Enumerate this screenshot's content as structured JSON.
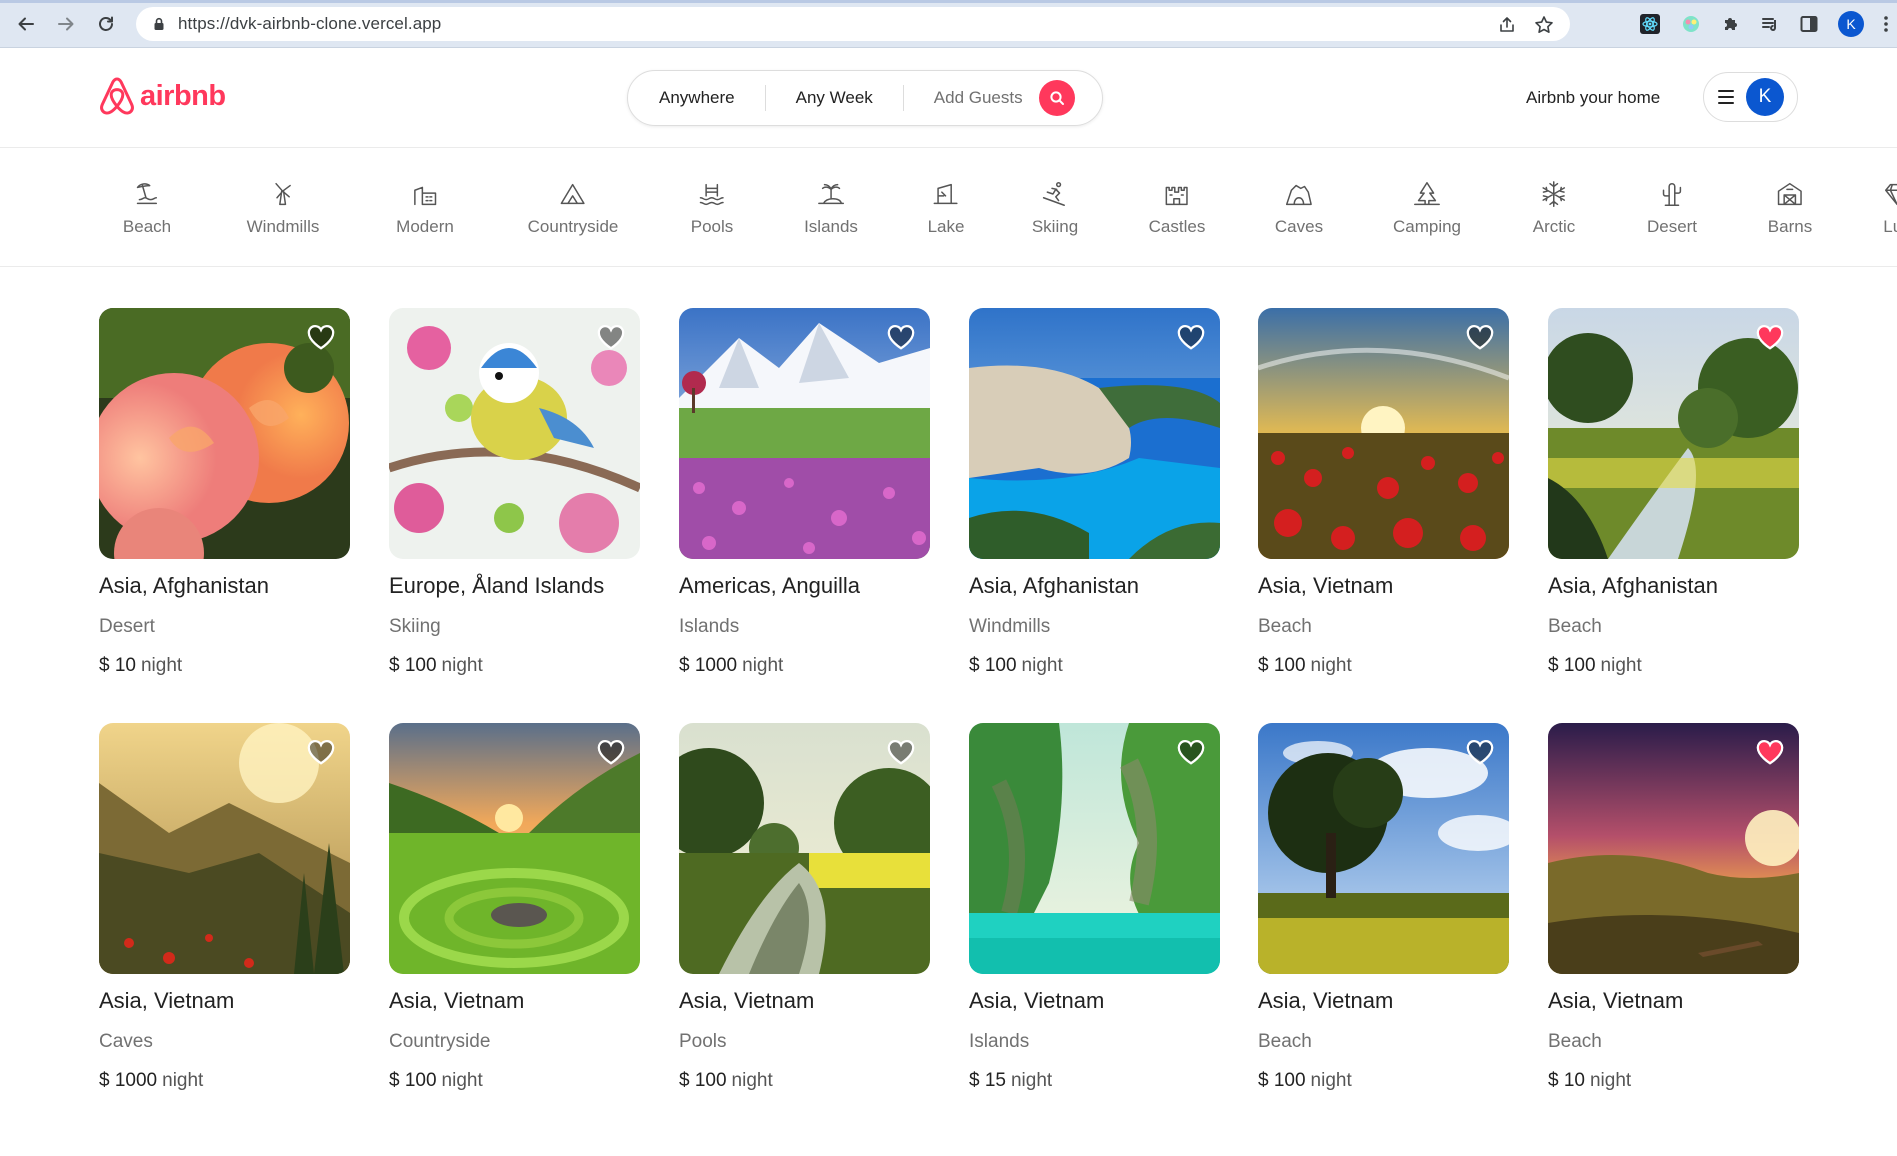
{
  "browser": {
    "url": "https://dvk-airbnb-clone.vercel.app",
    "profile_initial": "K"
  },
  "header": {
    "logo_text": "airbnb",
    "search": {
      "where": "Anywhere",
      "when": "Any Week",
      "who": "Add Guests"
    },
    "host_link": "Airbnb your home",
    "user_initial": "K"
  },
  "categories": [
    {
      "label": "Beach",
      "icon": "beach-icon"
    },
    {
      "label": "Windmills",
      "icon": "windmill-icon"
    },
    {
      "label": "Modern",
      "icon": "modern-building-icon"
    },
    {
      "label": "Countryside",
      "icon": "countryside-icon"
    },
    {
      "label": "Pools",
      "icon": "pool-icon"
    },
    {
      "label": "Islands",
      "icon": "island-icon"
    },
    {
      "label": "Lake",
      "icon": "lake-icon"
    },
    {
      "label": "Skiing",
      "icon": "skiing-icon"
    },
    {
      "label": "Castles",
      "icon": "castle-icon"
    },
    {
      "label": "Caves",
      "icon": "cave-icon"
    },
    {
      "label": "Camping",
      "icon": "camping-icon"
    },
    {
      "label": "Arctic",
      "icon": "snowflake-icon"
    },
    {
      "label": "Desert",
      "icon": "cactus-icon"
    },
    {
      "label": "Barns",
      "icon": "barn-icon"
    },
    {
      "label": "Lux",
      "icon": "diamond-icon"
    }
  ],
  "listings": [
    {
      "location": "Asia, Afghanistan",
      "category": "Desert",
      "price": "$ 10",
      "unit": "night",
      "favorite": false,
      "image": "orange-roses-photo"
    },
    {
      "location": "Europe, Åland Islands",
      "category": "Skiing",
      "price": "$ 100",
      "unit": "night",
      "favorite": false,
      "image": "blue-tit-bird-photo"
    },
    {
      "location": "Americas, Anguilla",
      "category": "Islands",
      "price": "$ 1000",
      "unit": "night",
      "favorite": false,
      "image": "mountain-flower-meadow-photo"
    },
    {
      "location": "Asia, Afghanistan",
      "category": "Windmills",
      "price": "$ 100",
      "unit": "night",
      "favorite": false,
      "image": "navagio-cove-photo"
    },
    {
      "location": "Asia, Vietnam",
      "category": "Beach",
      "price": "$ 100",
      "unit": "night",
      "favorite": false,
      "image": "poppy-field-sunset-photo"
    },
    {
      "location": "Asia, Afghanistan",
      "category": "Beach",
      "price": "$ 100",
      "unit": "night",
      "favorite": true,
      "image": "forest-stream-photo"
    },
    {
      "location": "Asia, Vietnam",
      "category": "Caves",
      "price": "$ 1000",
      "unit": "night",
      "favorite": false,
      "image": "mountain-valley-sunlight-photo"
    },
    {
      "location": "Asia, Vietnam",
      "category": "Countryside",
      "price": "$ 100",
      "unit": "night",
      "favorite": false,
      "image": "green-hills-stone-circle-photo"
    },
    {
      "location": "Asia, Vietnam",
      "category": "Pools",
      "price": "$ 100",
      "unit": "night",
      "favorite": false,
      "image": "river-trees-photo"
    },
    {
      "location": "Asia, Vietnam",
      "category": "Islands",
      "price": "$ 15",
      "unit": "night",
      "favorite": false,
      "image": "turquoise-lagoon-cliffs-photo"
    },
    {
      "location": "Asia, Vietnam",
      "category": "Beach",
      "price": "$ 100",
      "unit": "night",
      "favorite": false,
      "image": "lone-tree-field-photo"
    },
    {
      "location": "Asia, Vietnam",
      "category": "Beach",
      "price": "$ 10",
      "unit": "night",
      "favorite": true,
      "image": "purple-sunset-hills-photo"
    }
  ],
  "colors": {
    "brand": "#ff385c",
    "text": "#222222",
    "muted": "#717171",
    "border": "#dddddd"
  }
}
